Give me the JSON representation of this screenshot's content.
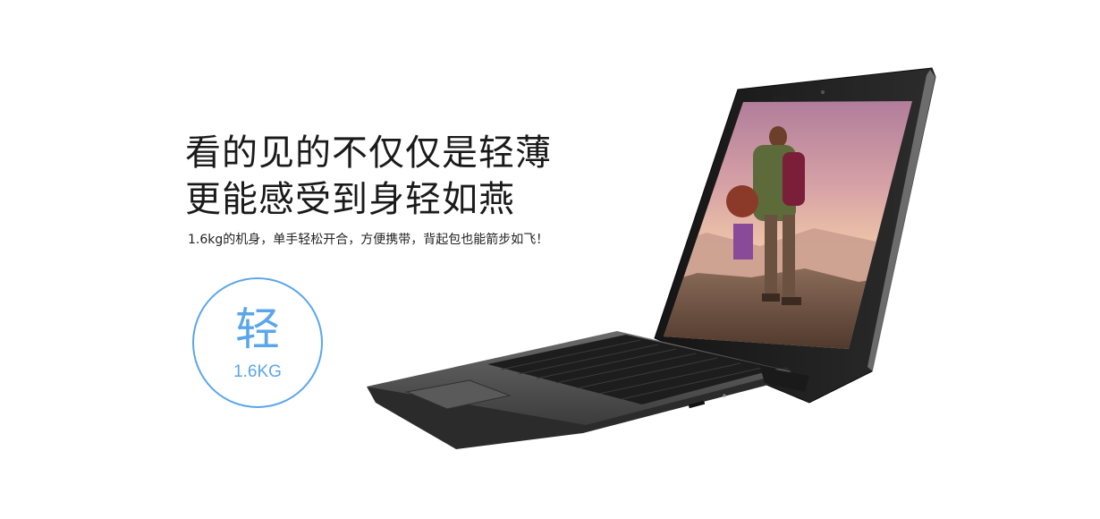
{
  "headline": {
    "line1": "看的见的不仅仅是轻薄",
    "line2": "更能感受到身轻如燕"
  },
  "subtitle": "1.6kg的机身，单手轻松开合，方便携带，背起包也能箭步如飞！",
  "badge": {
    "character": "轻",
    "weight": "1.6KG",
    "color": "#5aa6ea"
  },
  "product_image": {
    "description_icon": "laptop-icon",
    "screen_scene": "hiker-on-rock-sunset"
  }
}
